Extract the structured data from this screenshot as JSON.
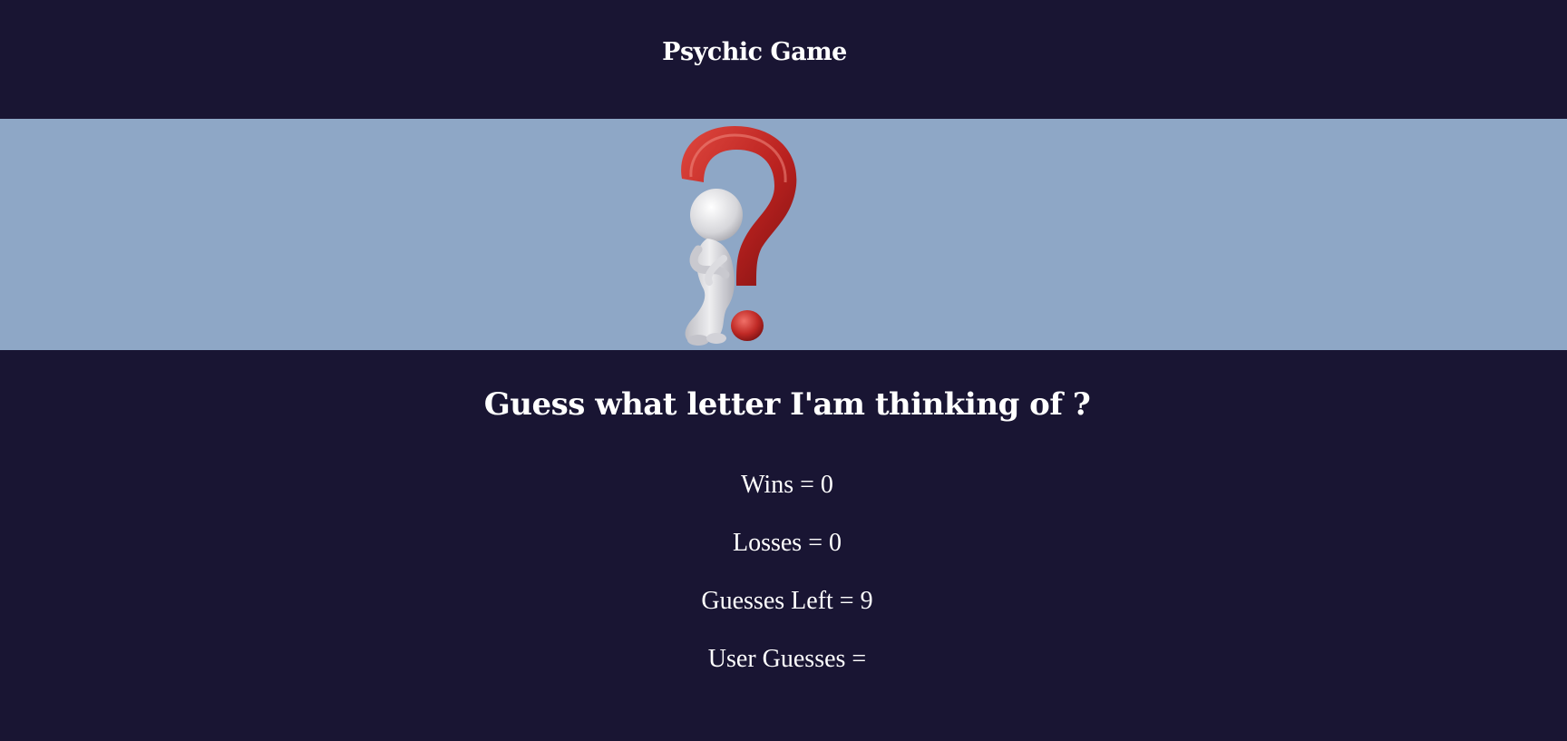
{
  "header": {
    "title": "Psychic Game"
  },
  "banner": {
    "image": "question-mark-thinking-figure"
  },
  "game": {
    "prompt": "Guess what letter I'am thinking of ?",
    "wins": "Wins = 0",
    "losses": "Losses = 0",
    "guesses_left": "Guesses Left = 9",
    "user_guesses": "User Guesses ="
  },
  "colors": {
    "background": "#191533",
    "banner": "#8ea7c6",
    "question_mark": "#c0282a",
    "figure": "#dcdcdc",
    "text": "#ffffff"
  }
}
